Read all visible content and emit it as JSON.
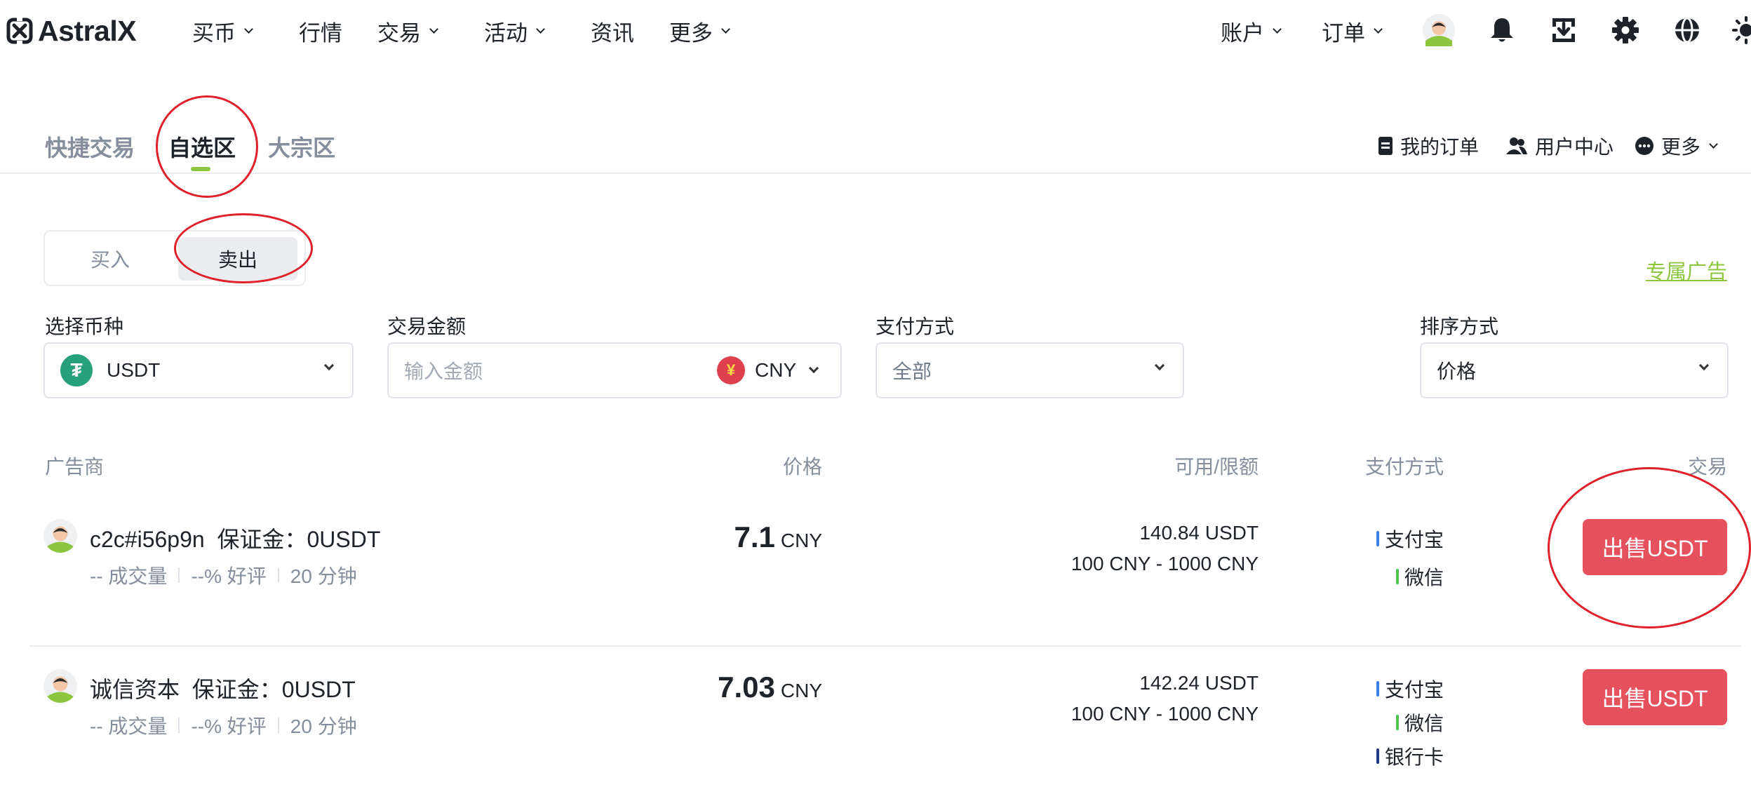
{
  "brand": {
    "name": "AstralX"
  },
  "nav": {
    "left": [
      {
        "label": "买币",
        "dropdown": true
      },
      {
        "label": "行情",
        "dropdown": false
      },
      {
        "label": "交易",
        "dropdown": true
      },
      {
        "label": "活动",
        "dropdown": true
      },
      {
        "label": "资讯",
        "dropdown": false
      },
      {
        "label": "更多",
        "dropdown": true
      }
    ],
    "right": [
      {
        "label": "账户",
        "dropdown": true
      },
      {
        "label": "订单",
        "dropdown": true
      }
    ],
    "icons": [
      "avatar",
      "bell-icon",
      "download-icon",
      "gear-icon",
      "globe-icon",
      "theme-icon"
    ]
  },
  "mode_tabs": {
    "items": [
      "快捷交易",
      "自选区",
      "大宗区"
    ],
    "active": "自选区"
  },
  "right_links": {
    "my_orders": "我的订单",
    "user_center": "用户中心",
    "more": "更多"
  },
  "side_toggle": {
    "buy": "买入",
    "sell": "卖出",
    "active": "卖出"
  },
  "exclusive_ads": "专属广告",
  "filters": {
    "coin": {
      "label": "选择币种",
      "value": "USDT",
      "icon_glyph": "₮"
    },
    "amount": {
      "label": "交易金额",
      "placeholder": "输入金额",
      "currency": "CNY",
      "currency_glyph": "¥"
    },
    "payment": {
      "label": "支付方式",
      "value": "全部"
    },
    "sort": {
      "label": "排序方式",
      "value": "价格"
    }
  },
  "table": {
    "headers": {
      "advertiser": "广告商",
      "price": "价格",
      "available": "可用/限额",
      "payment": "支付方式",
      "trade": "交易"
    },
    "rows": [
      {
        "merchant": "c2c#i56p9n",
        "deposit": "保证金：0USDT",
        "volume": "-- 成交量",
        "rating": "--% 好评",
        "time": "20 分钟",
        "price": "7.1",
        "price_unit": "CNY",
        "available": "140.84 USDT",
        "limit": "100 CNY - 1000 CNY",
        "payments": [
          {
            "name": "支付宝",
            "color": "#3c7ee8"
          },
          {
            "name": "微信",
            "color": "#4fc34f"
          }
        ],
        "action": "出售USDT"
      },
      {
        "merchant": "诚信资本",
        "deposit": "保证金：0USDT",
        "volume": "-- 成交量",
        "rating": "--% 好评",
        "time": "20 分钟",
        "price": "7.03",
        "price_unit": "CNY",
        "available": "142.24 USDT",
        "limit": "100 CNY - 1000 CNY",
        "payments": [
          {
            "name": "支付宝",
            "color": "#3c7ee8"
          },
          {
            "name": "微信",
            "color": "#4fc34f"
          },
          {
            "name": "银行卡",
            "color": "#1f3a8a"
          }
        ],
        "action": "出售USDT"
      }
    ]
  },
  "colors": {
    "accent_green": "#8cc63f",
    "sell_red": "#e5525e",
    "annotation_red": "#e0212b",
    "muted_text": "#848e9c"
  }
}
